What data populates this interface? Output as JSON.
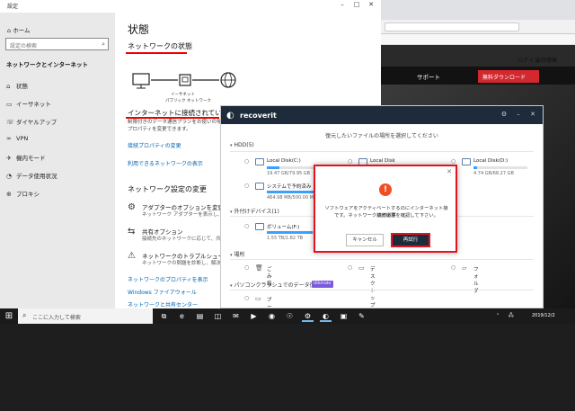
{
  "settings": {
    "title": "設定",
    "home": "ホーム",
    "search_placeholder": "設定の検索",
    "category": "ネットワークとインターネット",
    "nav": [
      {
        "label": "状態",
        "icon": "home-status-icon"
      },
      {
        "label": "イーサネット",
        "icon": "ethernet-icon"
      },
      {
        "label": "ダイヤルアップ",
        "icon": "phone-icon"
      },
      {
        "label": "VPN",
        "icon": "vpn-icon"
      },
      {
        "label": "機内モード",
        "icon": "airplane-icon"
      },
      {
        "label": "データ使用状況",
        "icon": "data-usage-icon"
      },
      {
        "label": "プロキシ",
        "icon": "globe-icon"
      }
    ],
    "page_title": "状態",
    "network_status": "ネットワークの状態",
    "diagram_ethernet": "イーサネット",
    "diagram_network": "パブリック ネットワーク",
    "connected": "インターネットに接続されています",
    "description": "制限付きのデータ通信プランをお使いの場合は、このネットワークを従量制課金接続に設定するか、その他のプロパティを変更できます。",
    "link_properties": "接続プロパティの変更",
    "link_available": "利用できるネットワークの表示",
    "settings_heading": "ネットワーク設定の変更",
    "options": [
      {
        "title": "アダプターのオプションを変更する",
        "desc": "ネットワーク アダプターを表示し、接続設定を変更します。",
        "icon": "adapter-icon"
      },
      {
        "title": "共有オプション",
        "desc": "接続先のネットワークに応じて、共有するものを決定します。",
        "icon": "share-icon"
      },
      {
        "title": "ネットワークのトラブルシューティング ツール",
        "desc": "ネットワークの問題を診断し、解決します。",
        "icon": "warning-icon"
      }
    ],
    "link_net_props": "ネットワークのプロパティを表示",
    "link_firewall": "Windows ファイアウォール",
    "link_sharing": "ネットワークと共有センター"
  },
  "browser": {
    "login": "ログイン",
    "company": "会社情報",
    "support": "サポート",
    "free_download": "無料ダウンロード"
  },
  "recoverit": {
    "app_name": "recoverit",
    "prompt": "復元したいファイルの場所を選択してください",
    "hdd_section": "HDD(5)",
    "drives": [
      {
        "name": "Local Disk(C:)",
        "size": "19.47 GB/79.95 GB",
        "fill": 0.24
      },
      {
        "name": "Local Disk",
        "size": "",
        "fill": 0.3
      },
      {
        "name": "Local Disk(D:)",
        "size": "4.74 GB/68.27 GB",
        "fill": 0.07
      },
      {
        "name": "システムで予約済み",
        "size": "464.98 MB/500.00 MB",
        "fill": 0.93
      }
    ],
    "external_section": "外付けデバイス(1)",
    "external": [
      {
        "name": "ボリューム(F:)",
        "size": "1.55 TB/1.82 TB",
        "fill": 0.85
      }
    ],
    "place_section": "場所",
    "places": [
      {
        "name": "ごみ箱",
        "icon": "trash-icon"
      },
      {
        "name": "デスクトップ",
        "icon": "desktop-icon"
      },
      {
        "name": "フォルダ",
        "icon": "folder-icon"
      }
    ],
    "advanced_section": "パソコンクラッシュでのデータ復元",
    "advanced_badge": "Ultimate",
    "advanced_item": "ブータブルメディアにデータを復元"
  },
  "dialog": {
    "message_line1": "ソフトウェアをアクティベートするのにインターネット接続が必要",
    "message_line2": "です。ネットワーク接続環境を確認して下さい。",
    "cancel": "キャンセル",
    "retry": "再試行"
  },
  "taskbar": {
    "search_placeholder": "ここに入力して検索",
    "tray_date": "2019/12/2"
  }
}
